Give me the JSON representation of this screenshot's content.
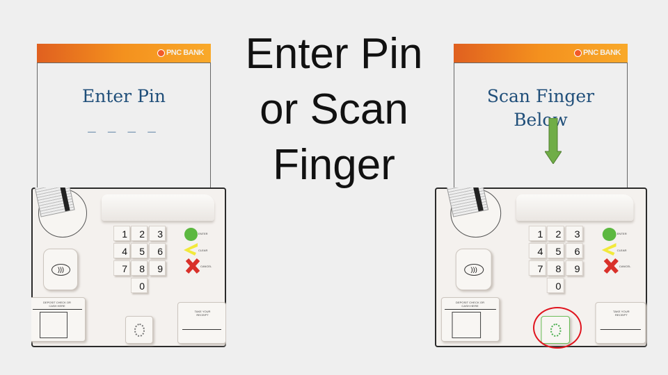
{
  "slide": {
    "title_lines": [
      "Enter Pin",
      "or Scan",
      "Finger"
    ]
  },
  "left_screen": {
    "brand": "PNC BANK",
    "heading": "Enter Pin",
    "pin_placeholder": "_ _ _ _"
  },
  "right_screen": {
    "brand": "PNC BANK",
    "heading_lines": [
      "Scan Finger",
      "Below"
    ],
    "arrow_icon": "down-arrow-icon",
    "arrow_color": "#70ad47"
  },
  "keypad": {
    "keys": [
      "1",
      "2",
      "3",
      "4",
      "5",
      "6",
      "7",
      "8",
      "9",
      "0"
    ],
    "enter_label": "ENTER",
    "clear_label": "CLEAR",
    "cancel_label": "CANCEL",
    "deposit_label": "DEPOSIT CHECK OR CASH HERE",
    "receipt_label": "TAKE YOUR RECEIPT",
    "colors": {
      "enter": "#5cb840",
      "clear": "#f2e93a",
      "cancel": "#d9312a",
      "highlight": "#e0141e"
    }
  }
}
